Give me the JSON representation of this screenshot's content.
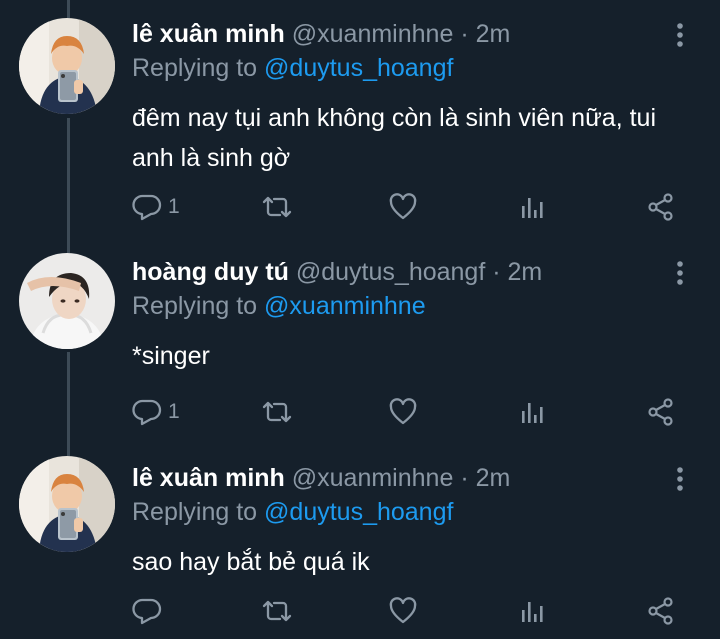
{
  "tweets": [
    {
      "display_name": "lê xuân minh",
      "handle": "@xuanminhne",
      "separator": "·",
      "time": "2m",
      "replying_prefix": "Replying to ",
      "replying_to": "@duytus_hoangf",
      "text": "đêm nay tụi anh không còn là sinh viên nữa, tui anh là sinh gờ",
      "reply_count": "1",
      "avatar_icon": "avatar-photo"
    },
    {
      "display_name": "hoàng duy tú",
      "handle": "@duytus_hoangf",
      "separator": "·",
      "time": "2m",
      "replying_prefix": "Replying to ",
      "replying_to": "@xuanminhne",
      "text": "*singer",
      "reply_count": "1",
      "avatar_icon": "avatar-photo"
    },
    {
      "display_name": "lê xuân minh",
      "handle": "@xuanminhne",
      "separator": "·",
      "time": "2m",
      "replying_prefix": "Replying to ",
      "replying_to": "@duytus_hoangf",
      "text": "sao hay bắt bẻ quá ik",
      "reply_count": "",
      "avatar_icon": "avatar-photo"
    }
  ],
  "colors": {
    "background": "#15202b",
    "primary_text": "#ffffff",
    "secondary_text": "#8b98a5",
    "accent": "#1d9bf0",
    "thread_line": "#3d4b57"
  }
}
